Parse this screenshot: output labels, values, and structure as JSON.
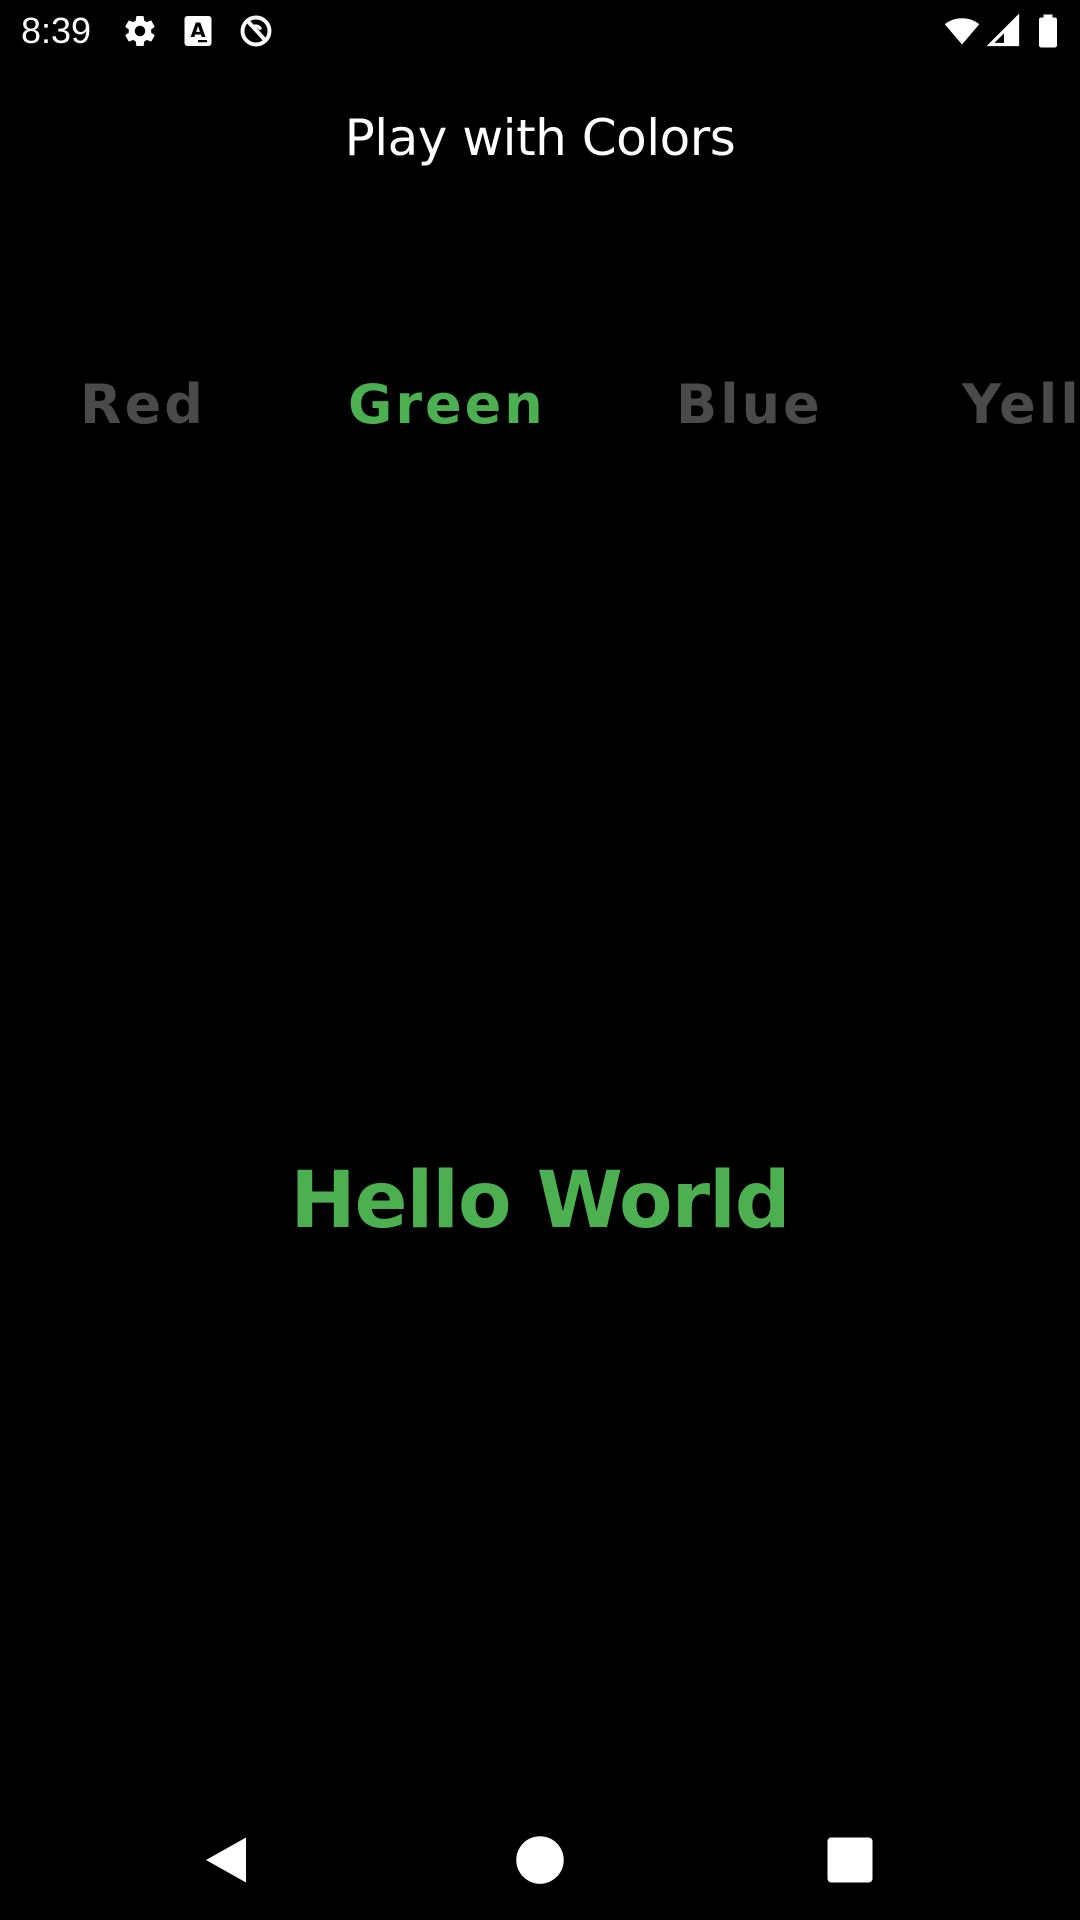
{
  "status_bar": {
    "time": "8:39",
    "icons": [
      "gear-icon",
      "keyboard-a-icon",
      "no-sync-icon",
      "wifi-icon",
      "signal-icon",
      "battery-icon"
    ]
  },
  "app": {
    "title": "Play with Colors"
  },
  "color_tabs": [
    {
      "label": "Red",
      "color": "#4a4a4a",
      "selected": false
    },
    {
      "label": "Green",
      "color": "#4caf50",
      "selected": true
    },
    {
      "label": "Blue",
      "color": "#4a4a4a",
      "selected": false
    },
    {
      "label": "Yello",
      "color": "#4a4a4a",
      "selected": false
    }
  ],
  "display": {
    "text": "Hello World",
    "color": "#4caf50"
  },
  "nav_bar": {
    "buttons": [
      "back-icon",
      "home-icon",
      "recents-icon"
    ]
  },
  "colors": {
    "background": "#000000",
    "foreground": "#ffffff",
    "accent": "#4caf50",
    "inactive_tab": "#4a4a4a"
  }
}
